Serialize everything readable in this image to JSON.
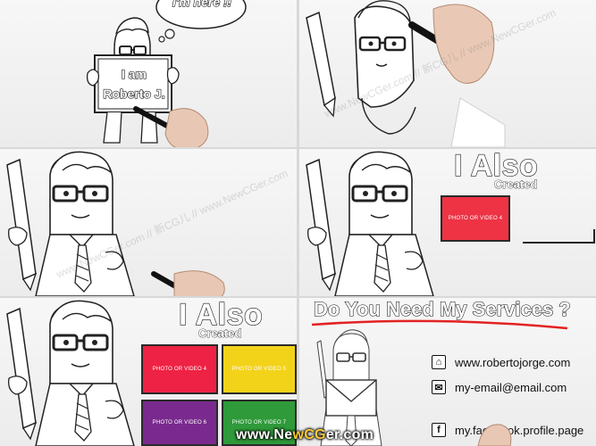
{
  "panel1": {
    "sign_line1": "I am",
    "sign_line2": "Roberto J.",
    "bubble_text": "I'm here !!"
  },
  "panel4": {
    "title": "I Also",
    "subtitle": "Created",
    "tile_label": "PHOTO OR VIDEO 4",
    "tile_color": "#ee3344"
  },
  "panel5": {
    "title": "I Also",
    "subtitle": "Created",
    "tiles": [
      {
        "label": "PHOTO OR VIDEO 4",
        "color": "#ee2244"
      },
      {
        "label": "PHOTO OR VIDEO 5",
        "color": "#f3d21a"
      },
      {
        "label": "PHOTO OR VIDEO 6",
        "color": "#7a2a8e"
      },
      {
        "label": "PHOTO OR VIDEO 7",
        "color": "#2f9a3a"
      }
    ]
  },
  "panel6": {
    "title": "Do You Need My Services ?",
    "accent_color": "#e32222",
    "contacts": [
      {
        "icon": "home-icon",
        "glyph": "⌂",
        "text": "www.robertojorge.com"
      },
      {
        "icon": "email-icon",
        "glyph": "✉",
        "text": "my-email@email.com"
      },
      {
        "icon": "facebook-icon",
        "glyph": "f",
        "text": "my.facebook.profile.page"
      }
    ]
  },
  "watermark": {
    "diagonal_text": "www.NewCGer.com // 新CG儿 // www.NewCGer.com",
    "logo_prefix": "www.Ne",
    "logo_highlight": "wCG",
    "logo_suffix": "er.com"
  }
}
